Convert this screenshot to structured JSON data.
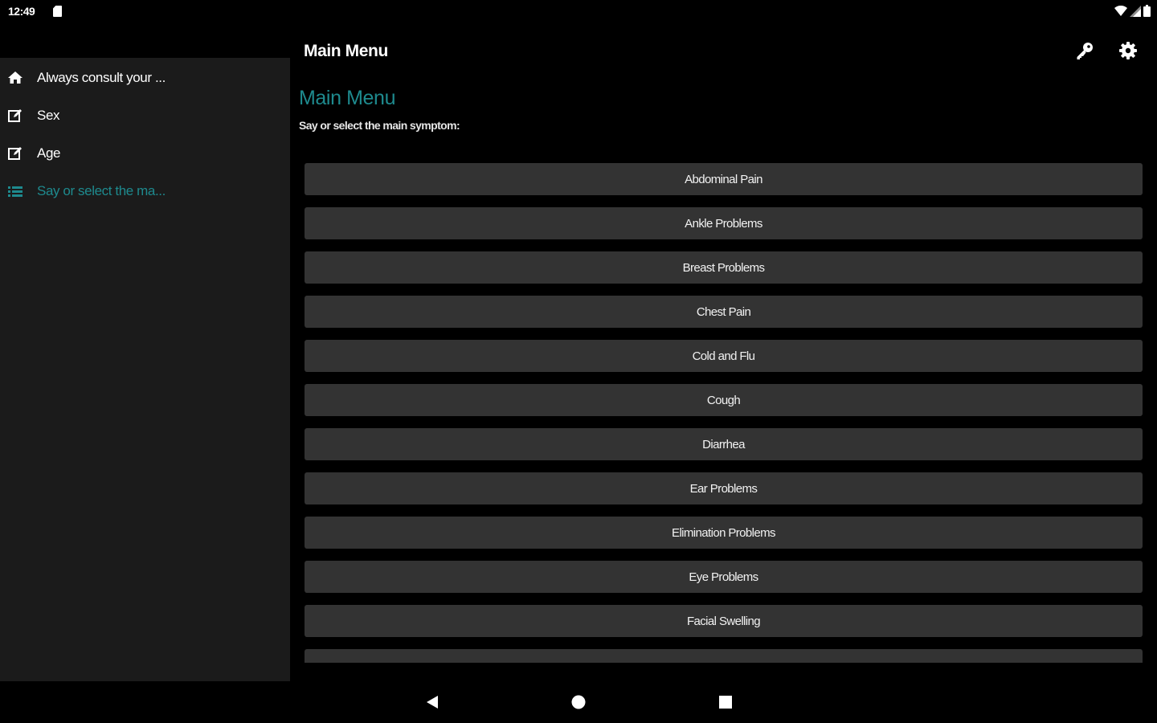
{
  "status_bar": {
    "time": "12:49",
    "icons": [
      "sd-card-icon",
      "wifi-icon",
      "cellular-signal-icon",
      "battery-icon"
    ]
  },
  "header": {
    "title": "Main Menu",
    "actions": [
      {
        "name": "key-icon"
      },
      {
        "name": "gear-icon"
      }
    ]
  },
  "sidebar": {
    "items": [
      {
        "label": "Always consult your ...",
        "icon": "home-icon",
        "active": false
      },
      {
        "label": "Sex",
        "icon": "edit-icon",
        "active": false
      },
      {
        "label": "Age",
        "icon": "edit-icon",
        "active": false
      },
      {
        "label": "Say or select the ma...",
        "icon": "list-icon",
        "active": true
      }
    ]
  },
  "content": {
    "heading": "Main Menu",
    "subheading": "Say or select the main symptom:",
    "symptoms": [
      "Abdominal Pain",
      "Ankle Problems",
      "Breast Problems",
      "Chest Pain",
      "Cold and Flu",
      "Cough",
      "Diarrhea",
      "Ear Problems",
      "Elimination Problems",
      "Eye Problems",
      "Facial Swelling",
      ""
    ]
  },
  "navigation_bar": {
    "buttons": [
      "back-icon",
      "home-circle-icon",
      "recents-icon"
    ]
  },
  "colors": {
    "accent": "#1e8a8e",
    "background": "#000000",
    "sidebar": "#1b1b1b",
    "button": "#333333"
  }
}
